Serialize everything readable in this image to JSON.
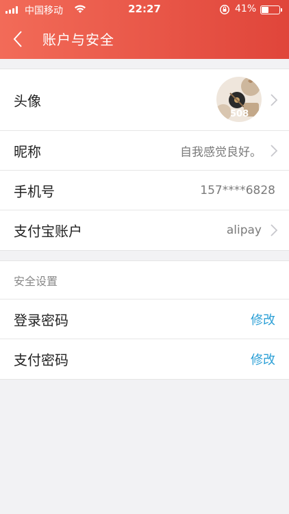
{
  "status_bar": {
    "carrier": "中国移动",
    "time": "22:27",
    "battery_percent": "41%",
    "battery_level": 0.41
  },
  "nav": {
    "title": "账户与安全",
    "back_icon": "chevron-left-icon"
  },
  "profile": {
    "avatar_label": "头像",
    "nickname_label": "昵称",
    "nickname_value": "自我感觉良好。",
    "phone_label": "手机号",
    "phone_value": "157****6828",
    "alipay_label": "支付宝账户",
    "alipay_value": "alipay"
  },
  "security": {
    "section_title": "安全设置",
    "login_password_label": "登录密码",
    "login_password_action": "修改",
    "pay_password_label": "支付密码",
    "pay_password_action": "修改"
  },
  "colors": {
    "header_start": "#f26b58",
    "header_end": "#e0453a",
    "action_blue": "#2a9fd6"
  }
}
